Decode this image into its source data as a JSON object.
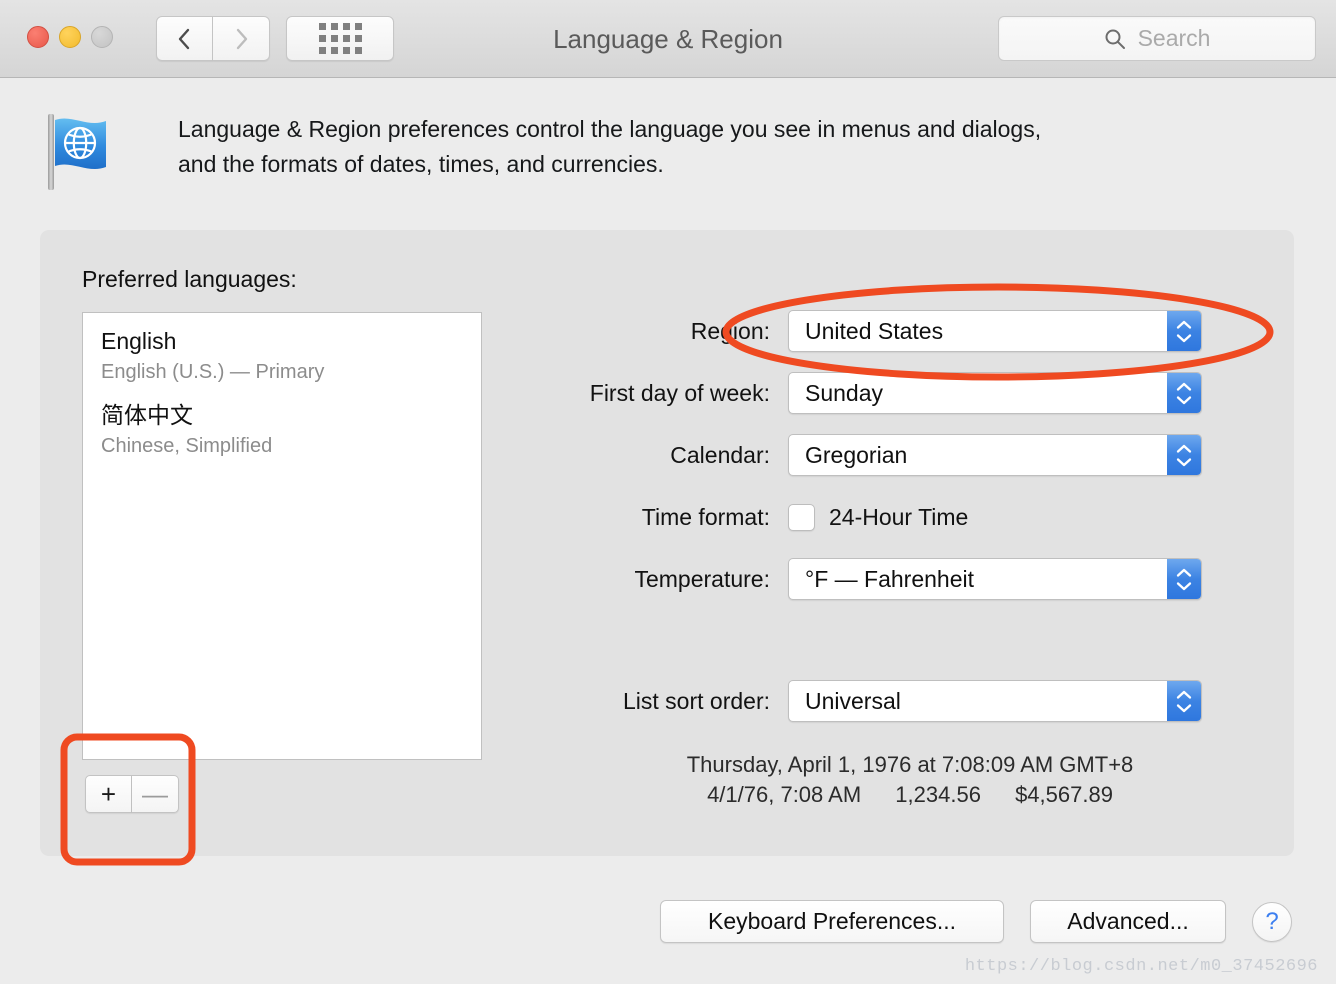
{
  "window": {
    "title": "Language & Region",
    "traffic_lights": [
      "close",
      "minimize",
      "zoom"
    ],
    "nav_back": "back-chevron",
    "nav_forward": "forward-chevron",
    "show_all": "grid-icon"
  },
  "search": {
    "placeholder": "Search",
    "icon": "search-icon"
  },
  "header": {
    "icon": "flag-globe-icon",
    "description_line1": "Language & Region preferences control the language you see in menus and dialogs,",
    "description_line2": "and the formats of dates, times, and currencies."
  },
  "languages": {
    "section_label": "Preferred languages:",
    "items": [
      {
        "name": "English",
        "detail": "English (U.S.) — Primary"
      },
      {
        "name": "简体中文",
        "detail": "Chinese, Simplified"
      }
    ],
    "add_button": "+",
    "remove_button": "—"
  },
  "settings": {
    "rows": [
      {
        "label": "Region:",
        "value": "United States",
        "type": "popup"
      },
      {
        "label": "First day of week:",
        "value": "Sunday",
        "type": "popup"
      },
      {
        "label": "Calendar:",
        "value": "Gregorian",
        "type": "popup"
      },
      {
        "label": "Time format:",
        "value": "24-Hour Time",
        "type": "checkbox",
        "checked": false
      },
      {
        "label": "Temperature:",
        "value": "°F — Fahrenheit",
        "type": "popup"
      },
      {
        "label": "List sort order:",
        "value": "Universal",
        "type": "popup"
      }
    ]
  },
  "preview": {
    "line1": "Thursday, April 1, 1976 at 7:08:09 AM GMT+8",
    "short_date": "4/1/76, 7:08 AM",
    "number": "1,234.56",
    "currency": "$4,567.89"
  },
  "footer": {
    "keyboard_preferences": "Keyboard Preferences...",
    "advanced": "Advanced...",
    "help": "?"
  },
  "annotations": {
    "color": "#ef4a21",
    "ellipse_target": "region-popup",
    "rect_target": "add-remove-language-buttons"
  },
  "watermark": "https://blog.csdn.net/m0_37452696"
}
